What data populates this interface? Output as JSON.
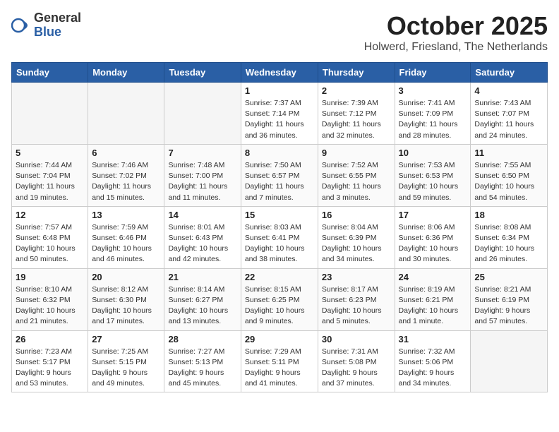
{
  "header": {
    "logo": {
      "general": "General",
      "blue": "Blue"
    },
    "title": "October 2025",
    "location": "Holwerd, Friesland, The Netherlands"
  },
  "days_of_week": [
    "Sunday",
    "Monday",
    "Tuesday",
    "Wednesday",
    "Thursday",
    "Friday",
    "Saturday"
  ],
  "weeks": [
    [
      {
        "day": "",
        "info": ""
      },
      {
        "day": "",
        "info": ""
      },
      {
        "day": "",
        "info": ""
      },
      {
        "day": "1",
        "info": "Sunrise: 7:37 AM\nSunset: 7:14 PM\nDaylight: 11 hours and 36 minutes."
      },
      {
        "day": "2",
        "info": "Sunrise: 7:39 AM\nSunset: 7:12 PM\nDaylight: 11 hours and 32 minutes."
      },
      {
        "day": "3",
        "info": "Sunrise: 7:41 AM\nSunset: 7:09 PM\nDaylight: 11 hours and 28 minutes."
      },
      {
        "day": "4",
        "info": "Sunrise: 7:43 AM\nSunset: 7:07 PM\nDaylight: 11 hours and 24 minutes."
      }
    ],
    [
      {
        "day": "5",
        "info": "Sunrise: 7:44 AM\nSunset: 7:04 PM\nDaylight: 11 hours and 19 minutes."
      },
      {
        "day": "6",
        "info": "Sunrise: 7:46 AM\nSunset: 7:02 PM\nDaylight: 11 hours and 15 minutes."
      },
      {
        "day": "7",
        "info": "Sunrise: 7:48 AM\nSunset: 7:00 PM\nDaylight: 11 hours and 11 minutes."
      },
      {
        "day": "8",
        "info": "Sunrise: 7:50 AM\nSunset: 6:57 PM\nDaylight: 11 hours and 7 minutes."
      },
      {
        "day": "9",
        "info": "Sunrise: 7:52 AM\nSunset: 6:55 PM\nDaylight: 11 hours and 3 minutes."
      },
      {
        "day": "10",
        "info": "Sunrise: 7:53 AM\nSunset: 6:53 PM\nDaylight: 10 hours and 59 minutes."
      },
      {
        "day": "11",
        "info": "Sunrise: 7:55 AM\nSunset: 6:50 PM\nDaylight: 10 hours and 54 minutes."
      }
    ],
    [
      {
        "day": "12",
        "info": "Sunrise: 7:57 AM\nSunset: 6:48 PM\nDaylight: 10 hours and 50 minutes."
      },
      {
        "day": "13",
        "info": "Sunrise: 7:59 AM\nSunset: 6:46 PM\nDaylight: 10 hours and 46 minutes."
      },
      {
        "day": "14",
        "info": "Sunrise: 8:01 AM\nSunset: 6:43 PM\nDaylight: 10 hours and 42 minutes."
      },
      {
        "day": "15",
        "info": "Sunrise: 8:03 AM\nSunset: 6:41 PM\nDaylight: 10 hours and 38 minutes."
      },
      {
        "day": "16",
        "info": "Sunrise: 8:04 AM\nSunset: 6:39 PM\nDaylight: 10 hours and 34 minutes."
      },
      {
        "day": "17",
        "info": "Sunrise: 8:06 AM\nSunset: 6:36 PM\nDaylight: 10 hours and 30 minutes."
      },
      {
        "day": "18",
        "info": "Sunrise: 8:08 AM\nSunset: 6:34 PM\nDaylight: 10 hours and 26 minutes."
      }
    ],
    [
      {
        "day": "19",
        "info": "Sunrise: 8:10 AM\nSunset: 6:32 PM\nDaylight: 10 hours and 21 minutes."
      },
      {
        "day": "20",
        "info": "Sunrise: 8:12 AM\nSunset: 6:30 PM\nDaylight: 10 hours and 17 minutes."
      },
      {
        "day": "21",
        "info": "Sunrise: 8:14 AM\nSunset: 6:27 PM\nDaylight: 10 hours and 13 minutes."
      },
      {
        "day": "22",
        "info": "Sunrise: 8:15 AM\nSunset: 6:25 PM\nDaylight: 10 hours and 9 minutes."
      },
      {
        "day": "23",
        "info": "Sunrise: 8:17 AM\nSunset: 6:23 PM\nDaylight: 10 hours and 5 minutes."
      },
      {
        "day": "24",
        "info": "Sunrise: 8:19 AM\nSunset: 6:21 PM\nDaylight: 10 hours and 1 minute."
      },
      {
        "day": "25",
        "info": "Sunrise: 8:21 AM\nSunset: 6:19 PM\nDaylight: 9 hours and 57 minutes."
      }
    ],
    [
      {
        "day": "26",
        "info": "Sunrise: 7:23 AM\nSunset: 5:17 PM\nDaylight: 9 hours and 53 minutes."
      },
      {
        "day": "27",
        "info": "Sunrise: 7:25 AM\nSunset: 5:15 PM\nDaylight: 9 hours and 49 minutes."
      },
      {
        "day": "28",
        "info": "Sunrise: 7:27 AM\nSunset: 5:13 PM\nDaylight: 9 hours and 45 minutes."
      },
      {
        "day": "29",
        "info": "Sunrise: 7:29 AM\nSunset: 5:11 PM\nDaylight: 9 hours and 41 minutes."
      },
      {
        "day": "30",
        "info": "Sunrise: 7:31 AM\nSunset: 5:08 PM\nDaylight: 9 hours and 37 minutes."
      },
      {
        "day": "31",
        "info": "Sunrise: 7:32 AM\nSunset: 5:06 PM\nDaylight: 9 hours and 34 minutes."
      },
      {
        "day": "",
        "info": ""
      }
    ]
  ]
}
